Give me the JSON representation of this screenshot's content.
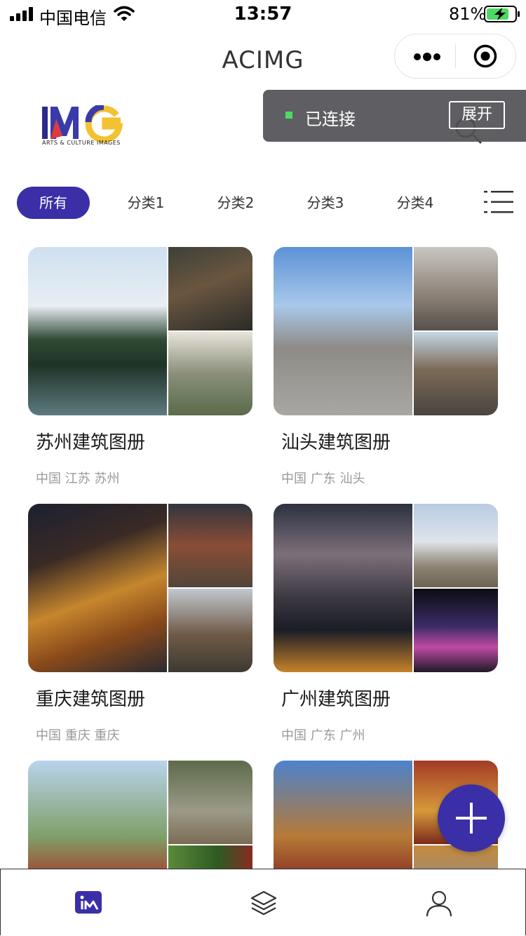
{
  "status_bar": {
    "carrier": "中国电信",
    "time": "13:57",
    "battery": "81%"
  },
  "nav": {
    "title": "ACIMG",
    "more_icon": "ellipsis-icon",
    "close_icon": "target-circle-icon"
  },
  "brand": {
    "logo_mark": "IMG",
    "logo_caption": "ARTS & CULTURE IMAGES"
  },
  "connection": {
    "status": "已连接",
    "expand_label": "展开",
    "status_color": "#4cd964"
  },
  "tabs": [
    {
      "label": "所有",
      "active": true
    },
    {
      "label": "分类1",
      "active": false
    },
    {
      "label": "分类2",
      "active": false
    },
    {
      "label": "分类3",
      "active": false
    },
    {
      "label": "分类4",
      "active": false
    }
  ],
  "albums": [
    {
      "title": "苏州建筑图册",
      "location": "中国 江苏 苏州"
    },
    {
      "title": "汕头建筑图册",
      "location": "中国 广东 汕头"
    },
    {
      "title": "重庆建筑图册",
      "location": "中国 重庆 重庆"
    },
    {
      "title": "广州建筑图册",
      "location": "中国 广东 广州"
    }
  ],
  "colors": {
    "accent": "#3a2fa6",
    "toast_bg": "#505056",
    "subtitle": "#999999"
  },
  "bottom_tabs": [
    {
      "icon": "image-gallery-icon",
      "active": true
    },
    {
      "icon": "layers-icon",
      "active": false
    },
    {
      "icon": "user-icon",
      "active": false
    }
  ],
  "fab": {
    "icon": "plus-icon"
  }
}
